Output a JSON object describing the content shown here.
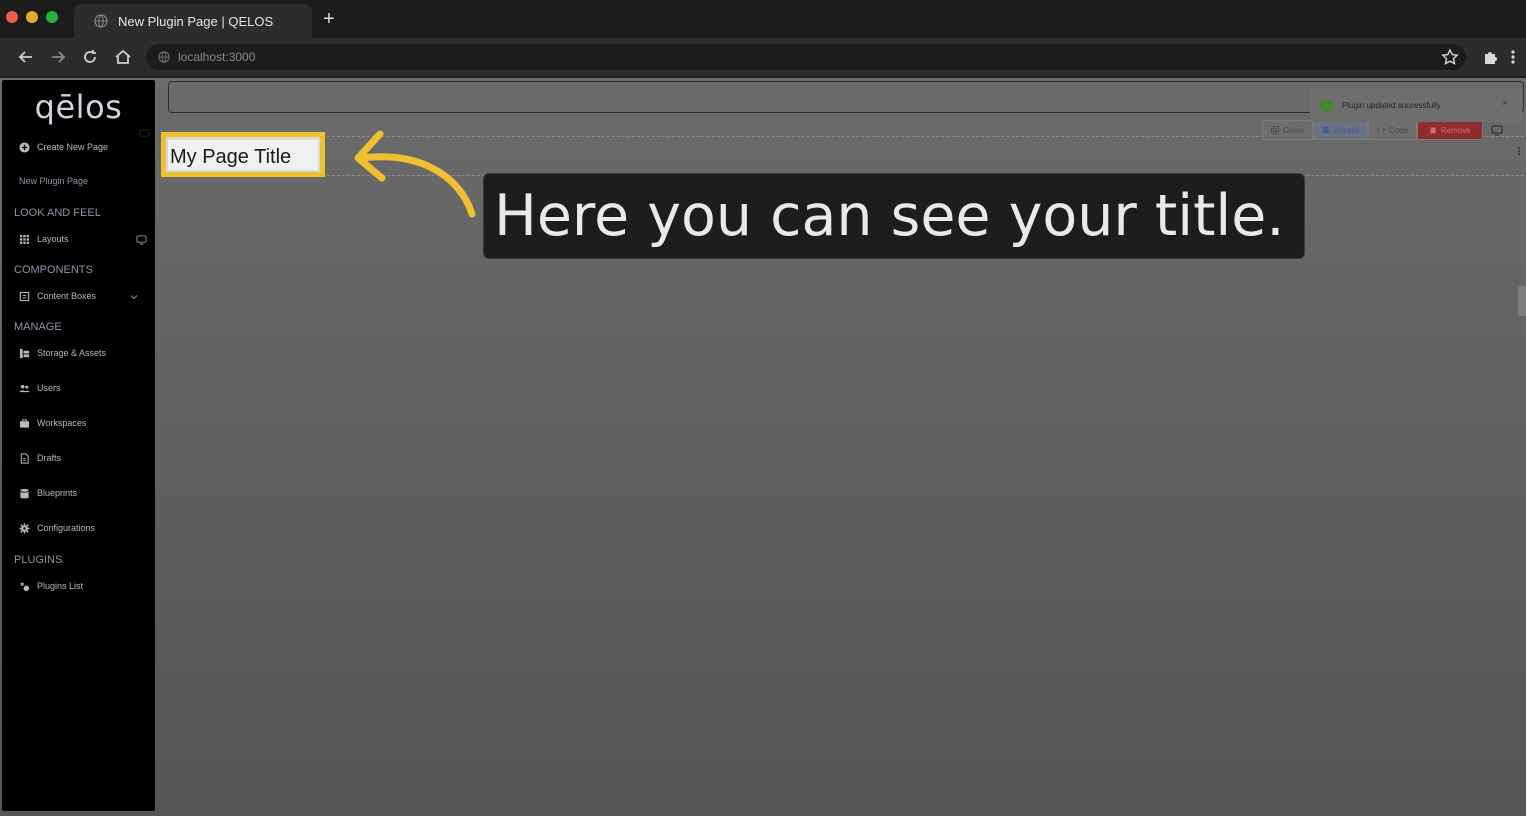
{
  "browser": {
    "tab_title": "New Plugin Page | QELOS",
    "new_tab_label": "+",
    "url": "localhost:3000"
  },
  "sidebar": {
    "logo": "qēlos",
    "create_page": "Create New Page",
    "new_plugin_page": "New Plugin Page",
    "sections": {
      "look_and_feel": "LOOK AND FEEL",
      "components": "COMPONENTS",
      "manage": "MANAGE",
      "plugins": "PLUGINS"
    },
    "items": {
      "layouts": "Layouts",
      "content_boxes": "Content Boxes",
      "storage_assets": "Storage & Assets",
      "users": "Users",
      "workspaces": "Workspaces",
      "drafts": "Drafts",
      "blueprints": "Blueprints",
      "configurations": "Configurations",
      "plugins_list": "Plugins List"
    }
  },
  "editor": {
    "page_title": "My Page Title",
    "actions": {
      "clone": "Clone",
      "wizard": "Wizard",
      "code": "Code",
      "remove": "Remove"
    }
  },
  "toast": {
    "message": "Plugin updated successfully",
    "close": "×"
  },
  "tooltip": {
    "text": "Here you can see your title."
  },
  "colors": {
    "highlight": "#efc030",
    "remove": "#8c2e2e",
    "success": "#3d8b26"
  }
}
